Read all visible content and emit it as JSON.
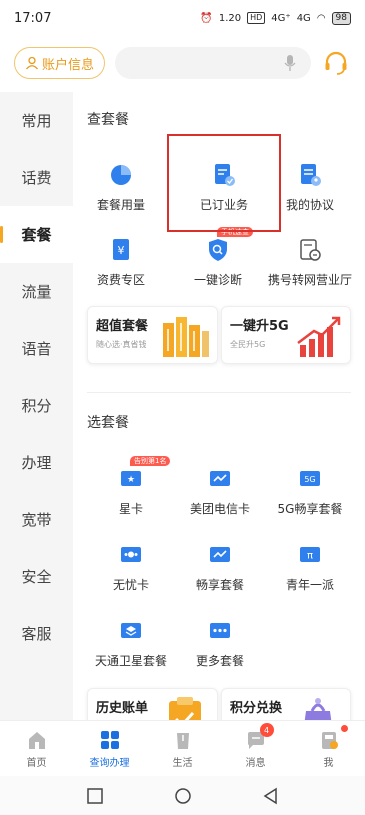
{
  "status_bar": {
    "time": "17:07",
    "speed": "1.20",
    "net_a": "4G⁺",
    "net_b": "4G",
    "battery": "98"
  },
  "header": {
    "account_label": "账户信息"
  },
  "sidebar": {
    "items": [
      {
        "label": "常用"
      },
      {
        "label": "话费"
      },
      {
        "label": "套餐",
        "active": true
      },
      {
        "label": "流量"
      },
      {
        "label": "语音"
      },
      {
        "label": "积分"
      },
      {
        "label": "办理"
      },
      {
        "label": "宽带"
      },
      {
        "label": "安全"
      },
      {
        "label": "客服"
      }
    ]
  },
  "check_plan": {
    "title": "查套餐",
    "items": [
      {
        "label": "套餐用量",
        "icon": "pie-chart-icon"
      },
      {
        "label": "已订业务",
        "icon": "subscribed-doc-icon"
      },
      {
        "label": "我的协议",
        "icon": "agreement-doc-icon"
      },
      {
        "label": "资费专区",
        "icon": "tariff-book-icon"
      },
      {
        "label": "一键诊断",
        "icon": "diagnose-shield-icon",
        "tag": "手机速查"
      },
      {
        "label": "携号转网营业厅",
        "icon": "transfer-network-icon"
      }
    ],
    "cards": [
      {
        "title": "超值套餐",
        "subtitle": "随心选·真省钱"
      },
      {
        "title": "一键升5G",
        "subtitle": "全民升5G"
      }
    ]
  },
  "choose_plan": {
    "title": "选套餐",
    "items": [
      {
        "label": "星卡",
        "icon": "star-card-icon",
        "tag": "告别第1名"
      },
      {
        "label": "美团电信卡",
        "icon": "meituan-card-icon"
      },
      {
        "label": "5G畅享套餐",
        "icon": "5g-plan-icon",
        "glyph": "5G"
      },
      {
        "label": "无忧卡",
        "icon": "worry-free-card-icon"
      },
      {
        "label": "畅享套餐",
        "icon": "enjoy-plan-icon"
      },
      {
        "label": "青年一派",
        "icon": "youth-plan-icon",
        "glyph": "π"
      },
      {
        "label": "天通卫星套餐",
        "icon": "satellite-plan-icon"
      },
      {
        "label": "更多套餐",
        "icon": "more-plans-icon"
      }
    ],
    "cards": [
      {
        "title": "历史账单"
      },
      {
        "title": "积分兑换"
      }
    ]
  },
  "bottom_nav": {
    "items": [
      {
        "label": "首页",
        "icon": "home-icon"
      },
      {
        "label": "查询办理",
        "icon": "query-grid-icon",
        "active": true
      },
      {
        "label": "生活",
        "icon": "life-icon"
      },
      {
        "label": "消息",
        "icon": "message-icon",
        "badge": "4"
      },
      {
        "label": "我",
        "icon": "me-icon"
      }
    ]
  },
  "colors": {
    "accent_orange": "#f5a623",
    "primary_blue": "#1b6fe0",
    "highlight_red": "#d9302c",
    "badge_red": "#ff4d3a"
  }
}
